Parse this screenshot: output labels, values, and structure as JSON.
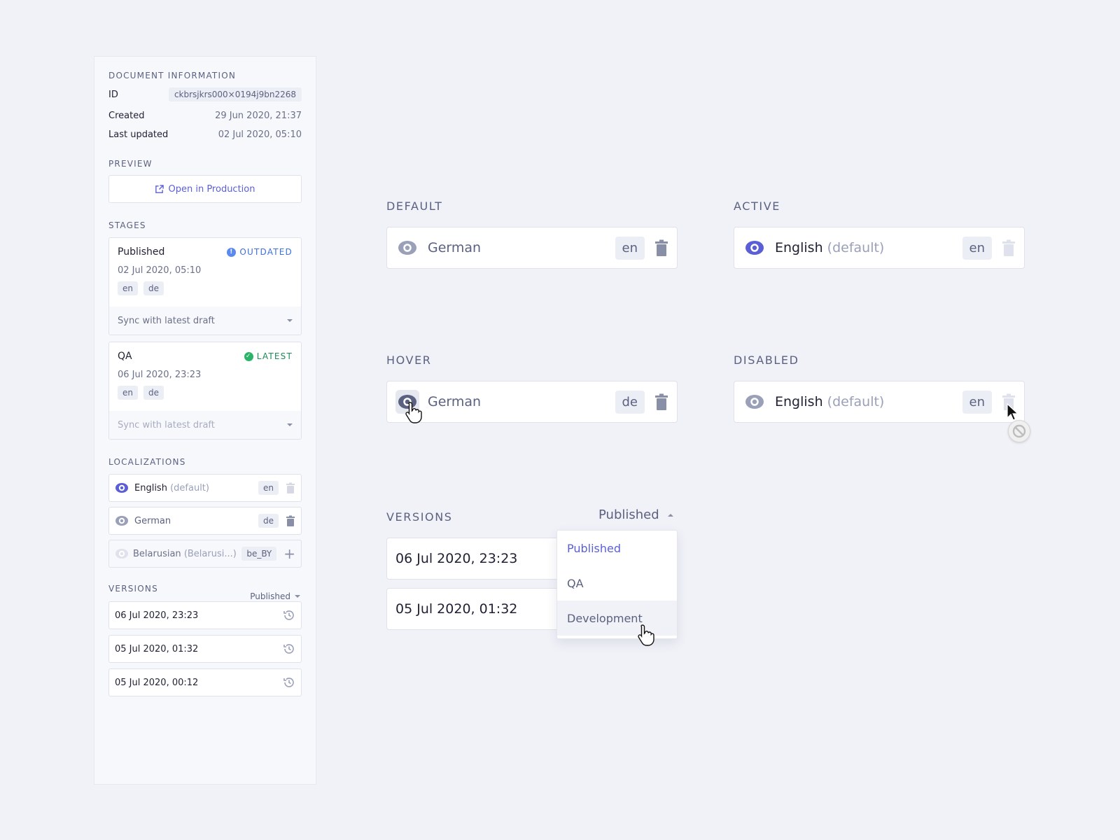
{
  "sidebar": {
    "doc_info": {
      "title": "DOCUMENT INFORMATION",
      "id_label": "ID",
      "id_value": "ckbrsjkrs000×0194j9bn2268",
      "created_label": "Created",
      "created_value": "29 Jun 2020, 21:37",
      "updated_label": "Last updated",
      "updated_value": "02 Jul 2020, 05:10"
    },
    "preview": {
      "title": "PREVIEW",
      "button_label": "Open in Production"
    },
    "stages": {
      "title": "STAGES",
      "items": [
        {
          "name": "Published",
          "status": "OUTDATED",
          "date": "02 Jul 2020, 05:10",
          "tags": [
            "en",
            "de"
          ],
          "sync_label": "Sync with latest draft"
        },
        {
          "name": "QA",
          "status": "LATEST",
          "date": "06 Jul 2020, 23:23",
          "tags": [
            "en",
            "de"
          ],
          "sync_label": "Sync with latest draft"
        }
      ]
    },
    "localizations": {
      "title": "LOCALIZATIONS",
      "items": [
        {
          "name": "English",
          "note": "(default)",
          "code": "en"
        },
        {
          "name": "German",
          "note": "",
          "code": "de"
        },
        {
          "name": "Belarusian",
          "note": "(Belarusi...)",
          "code": "be_BY"
        }
      ]
    },
    "versions": {
      "title": "VERSIONS",
      "dropdown": "Published",
      "items": [
        "06 Jul 2020, 23:23",
        "05 Jul 2020, 01:32",
        "05 Jul 2020, 00:12"
      ]
    }
  },
  "showcase": {
    "default": {
      "title": "DEFAULT",
      "name": "German",
      "note": "",
      "code": "en"
    },
    "active": {
      "title": "ACTIVE",
      "name": "English",
      "note": "(default)",
      "code": "en"
    },
    "hover": {
      "title": "HOVER",
      "name": "German",
      "note": "",
      "code": "de"
    },
    "disabled": {
      "title": "DISABLED",
      "name": "English",
      "note": "(default)",
      "code": "en"
    },
    "versions": {
      "title": "VERSIONS",
      "dropdown": "Published",
      "items": [
        "06 Jul 2020, 23:23",
        "05 Jul 2020, 01:32"
      ],
      "menu": [
        "Published",
        "QA",
        "Development"
      ]
    }
  },
  "colors": {
    "accent": "#5b5fd6",
    "eye_active": "#5b5fd6",
    "eye_inactive": "#9aa0b8",
    "outdated": "#3d6fe0",
    "latest": "#1e8a57"
  }
}
